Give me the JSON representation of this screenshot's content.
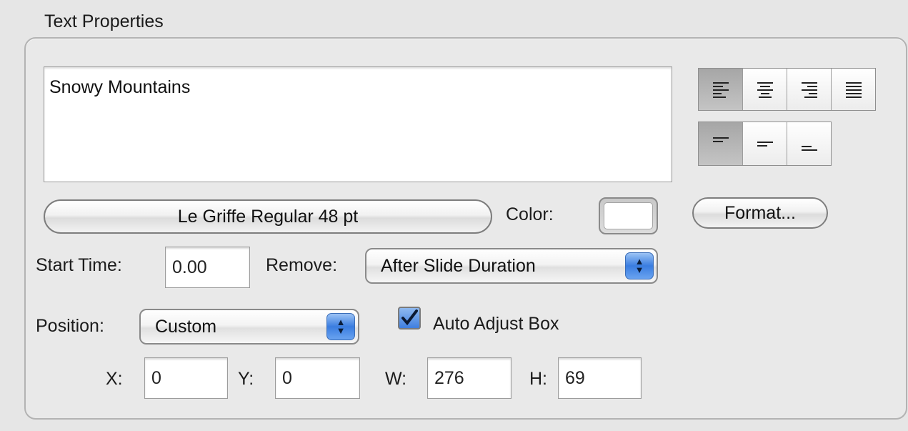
{
  "group": {
    "title": "Text Properties"
  },
  "text_area": {
    "value": "Snowy Mountains"
  },
  "alignment": {
    "horizontal": [
      "align-left",
      "align-center",
      "align-right",
      "align-justify"
    ],
    "horizontal_selected": "align-left",
    "vertical": [
      "align-top",
      "align-middle",
      "align-bottom"
    ],
    "vertical_selected": "align-top"
  },
  "font_button": {
    "label": "Le Griffe Regular 48 pt"
  },
  "color": {
    "label": "Color:",
    "value": "#ffffff"
  },
  "format_button": {
    "label": "Format..."
  },
  "start_time": {
    "label": "Start Time:",
    "value": "0.00"
  },
  "remove": {
    "label": "Remove:",
    "value": "After Slide Duration"
  },
  "position": {
    "label": "Position:",
    "value": "Custom"
  },
  "auto_adjust": {
    "label": "Auto Adjust Box",
    "checked": true
  },
  "geometry": {
    "x_label": "X:",
    "x_value": "0",
    "y_label": "Y:",
    "y_value": "0",
    "w_label": "W:",
    "w_value": "276",
    "h_label": "H:",
    "h_value": "69"
  },
  "colors": {
    "accent": "#3f7fe0",
    "background": "#e6e6e6"
  }
}
